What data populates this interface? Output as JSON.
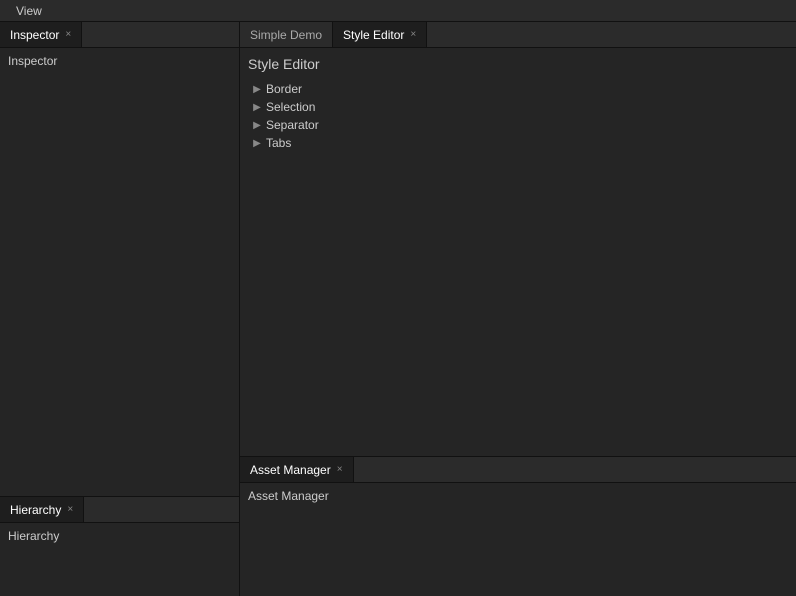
{
  "menuBar": {
    "items": [
      {
        "label": "View"
      }
    ]
  },
  "leftPanel": {
    "topSection": {
      "tabs": [
        {
          "label": "Inspector",
          "active": true,
          "closable": true
        }
      ],
      "content": "Inspector"
    },
    "bottomSection": {
      "tabs": [
        {
          "label": "Hierarchy",
          "active": true,
          "closable": true
        }
      ],
      "content": "Hierarchy"
    }
  },
  "rightPanel": {
    "topTabs": [
      {
        "label": "Simple Demo",
        "active": false,
        "closable": false
      },
      {
        "label": "Style Editor",
        "active": true,
        "closable": true
      }
    ],
    "styleEditor": {
      "title": "Style Editor",
      "treeItems": [
        {
          "label": "Border",
          "expanded": false
        },
        {
          "label": "Selection",
          "expanded": false
        },
        {
          "label": "Separator",
          "expanded": false
        },
        {
          "label": "Tabs",
          "expanded": false
        }
      ]
    },
    "bottomSection": {
      "tabs": [
        {
          "label": "Asset Manager",
          "active": true,
          "closable": true
        }
      ],
      "content": "Asset Manager"
    }
  },
  "icons": {
    "close": "×",
    "arrow_right": "▶"
  }
}
